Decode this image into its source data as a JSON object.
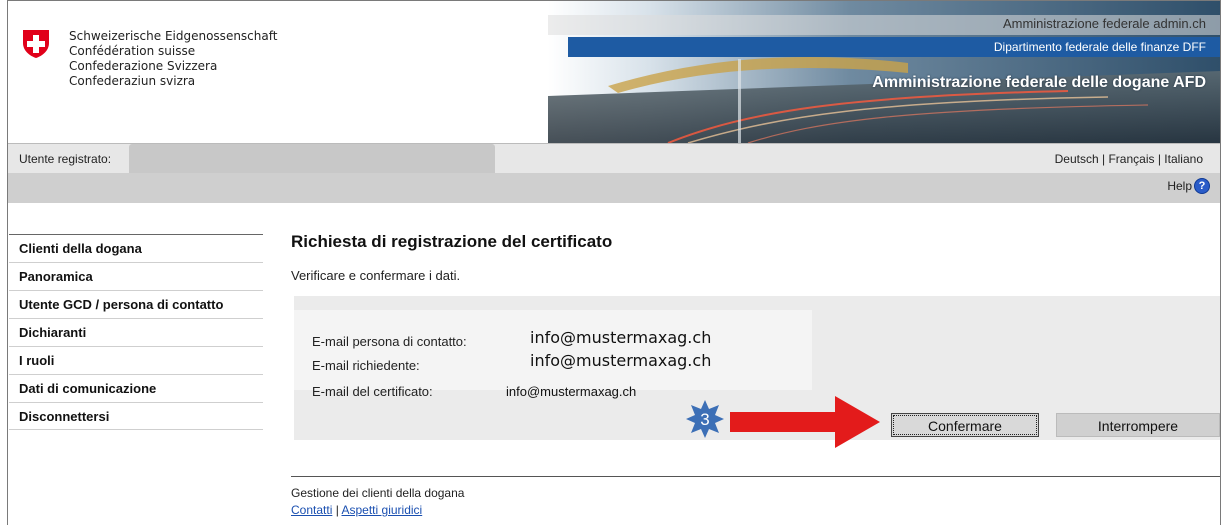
{
  "header": {
    "confederation_lines": [
      "Schweizerische Eidgenossenschaft",
      "Confédération suisse",
      "Confederazione Svizzera",
      "Confederaziun svizra"
    ],
    "admin_title": "Amministrazione federale admin.ch",
    "department": "Dipartimento federale delle finanze DFF",
    "agency": "Amministrazione federale delle dogane AFD"
  },
  "userbar": {
    "user_label": "Utente registrato:",
    "languages": [
      "Deutsch",
      "Français",
      "Italiano"
    ],
    "separator": "|"
  },
  "help": {
    "label": "Help",
    "icon": "?"
  },
  "sidebar": {
    "items": [
      {
        "label": "Clienti della dogana"
      },
      {
        "label": "Panoramica"
      },
      {
        "label": "Utente GCD / persona di contatto"
      },
      {
        "label": "Dichiaranti"
      },
      {
        "label": "I ruoli"
      },
      {
        "label": "Dati di comunicazione"
      },
      {
        "label": "Disconnettersi"
      }
    ]
  },
  "main": {
    "title": "Richiesta di registrazione del certificato",
    "instruction": "Verificare e confermare i dati.",
    "fields": [
      {
        "label": "E-mail persona di contatto:",
        "value": "info@mustermaxag.ch"
      },
      {
        "label": "E-mail richiedente:",
        "value": "info@mustermaxag.ch"
      },
      {
        "label": "E-mail del certificato:",
        "value": "info@mustermaxag.ch"
      }
    ],
    "confirm_label": "Confermare",
    "cancel_label": "Interrompere",
    "step_badge": "3"
  },
  "footer": {
    "title": "Gestione dei clienti della dogana",
    "links": [
      "Contatti",
      "Aspetti giuridici"
    ],
    "separator": "|"
  },
  "colors": {
    "department_bar": "#1e5ba3",
    "annotation_arrow": "#e31b1b",
    "badge": "#3c6fb6"
  }
}
